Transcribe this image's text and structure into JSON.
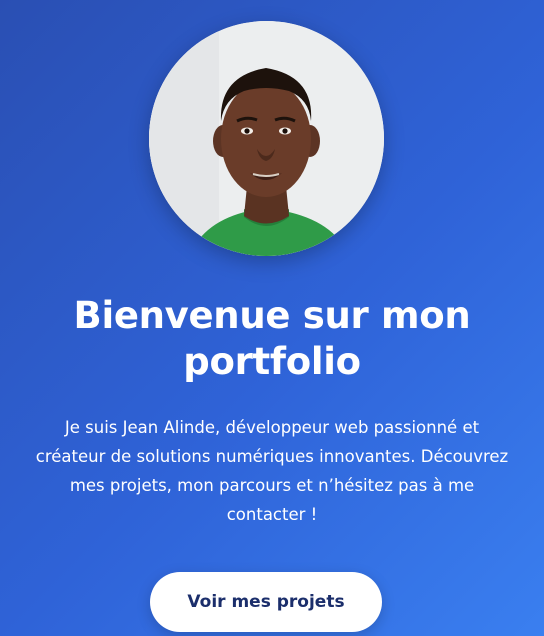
{
  "hero": {
    "avatar_alt": "Jean Alinde",
    "title": "Bienvenue sur mon portfolio",
    "intro": "Je suis Jean Alinde, développeur web passionné et créateur de solutions numériques innovantes. Découvrez mes projets, mon parcours et n’hésitez pas à me contacter !",
    "cta_label": "Voir mes projets",
    "colors": {
      "gradient_start": "#2a4fb3",
      "gradient_end": "#3a7ff0",
      "button_bg": "#ffffff",
      "button_text": "#1b2e6b",
      "text": "#ffffff"
    }
  }
}
